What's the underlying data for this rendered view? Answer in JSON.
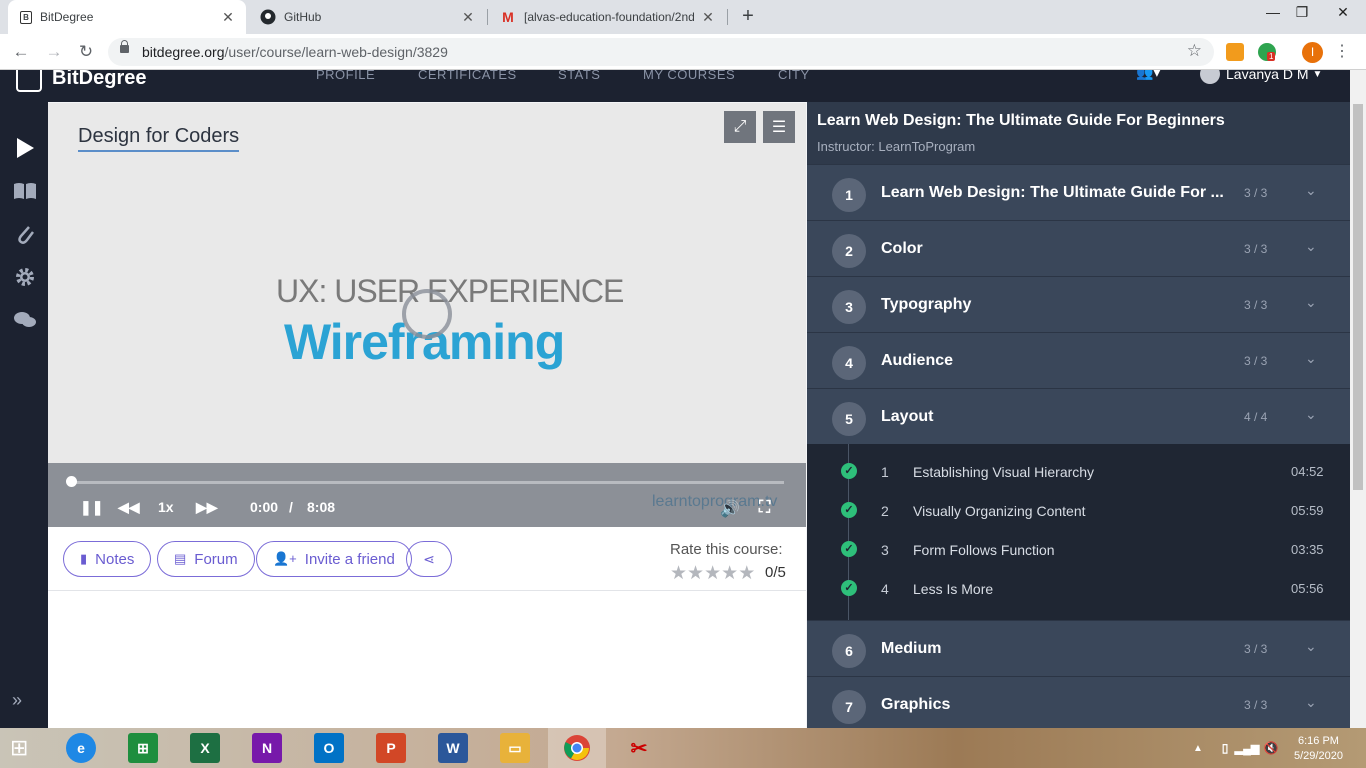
{
  "browser": {
    "tabs": [
      {
        "title": "BitDegree",
        "icon": "bitdegree-favicon"
      },
      {
        "title": "GitHub",
        "icon": "github-icon"
      },
      {
        "title": "[alvas-education-foundation/2nd",
        "icon": "gmail-icon"
      }
    ],
    "new_tab": "+",
    "url_host": "bitdegree.org",
    "url_path": "/user/course/learn-web-design/3829",
    "profile_initial": "I",
    "extension_badge": "1"
  },
  "site": {
    "logo": "BitDegree",
    "nav": [
      "PROFILE",
      "CERTIFICATES",
      "STATS",
      "MY COURSES",
      "CITY"
    ],
    "user": "Lavanya D M"
  },
  "video": {
    "title": "Design for Coders",
    "slide_line1": "UX: USER EXPERIENCE",
    "slide_line2": "Wireframing",
    "speed": "1x",
    "current_time": "0:00",
    "separator": "/",
    "duration": "8:08",
    "brand": "learntoprogram.tv",
    "progress": 0
  },
  "actions": {
    "notes": "Notes",
    "forum": "Forum",
    "invite": "Invite a friend",
    "rate_label": "Rate this course:",
    "rating": "0/5"
  },
  "course": {
    "title": "Learn Web Design: The Ultimate Guide For Beginners",
    "instructor": "Instructor: LearnToProgram",
    "sections": [
      {
        "num": "1",
        "name": "Learn Web Design: The Ultimate Guide For ...",
        "count": "3 / 3"
      },
      {
        "num": "2",
        "name": "Color",
        "count": "3 / 3"
      },
      {
        "num": "3",
        "name": "Typography",
        "count": "3 / 3"
      },
      {
        "num": "4",
        "name": "Audience",
        "count": "3 / 3"
      },
      {
        "num": "5",
        "name": "Layout",
        "count": "4 / 4"
      },
      {
        "num": "6",
        "name": "Medium",
        "count": "3 / 3"
      },
      {
        "num": "7",
        "name": "Graphics",
        "count": "3 / 3"
      }
    ],
    "lessons": [
      {
        "num": "1",
        "name": "Establishing Visual Hierarchy",
        "time": "04:52"
      },
      {
        "num": "2",
        "name": "Visually Organizing Content",
        "time": "05:59"
      },
      {
        "num": "3",
        "name": "Form Follows Function",
        "time": "03:35"
      },
      {
        "num": "4",
        "name": "Less Is More",
        "time": "05:56"
      }
    ]
  },
  "taskbar": {
    "time": "6:16 PM",
    "date": "5/29/2020"
  }
}
